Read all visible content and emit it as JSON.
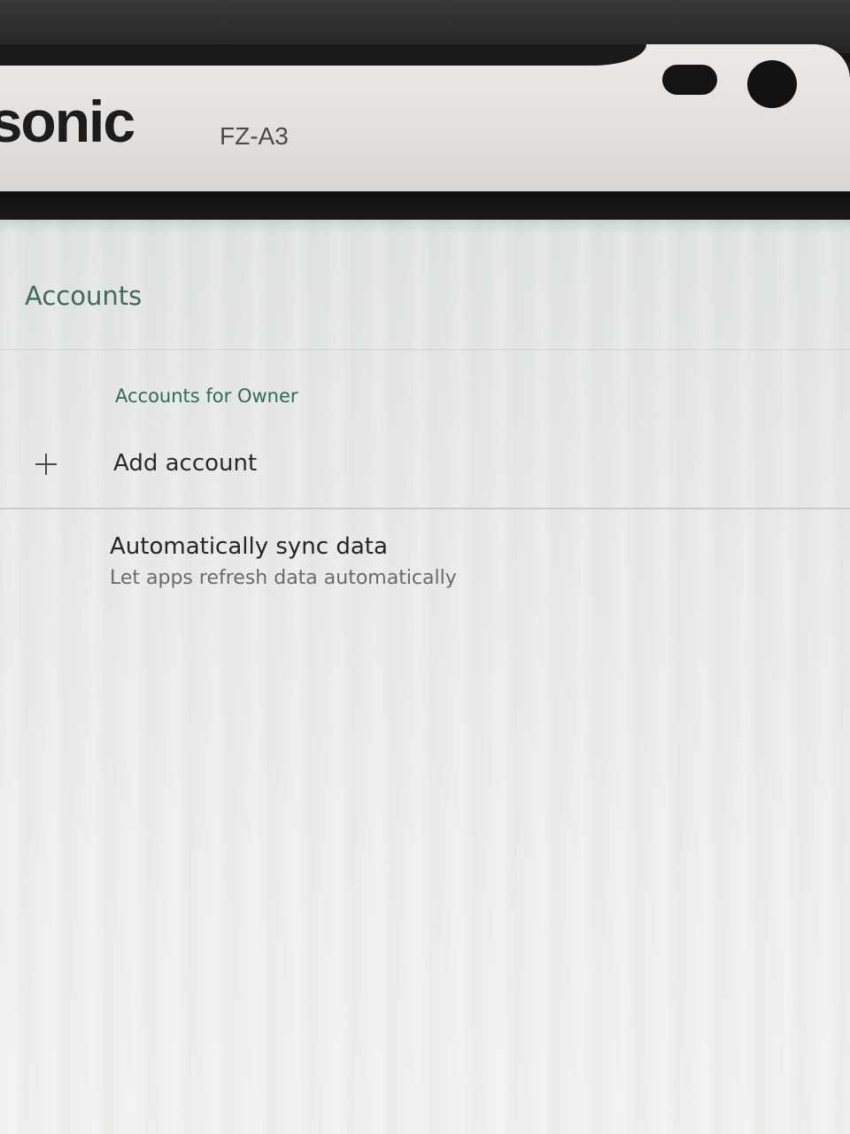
{
  "device": {
    "brand": "asonic",
    "model": "FZ-A3"
  },
  "app_bar": {
    "title": "Accounts"
  },
  "accounts_section": {
    "header": "Accounts for Owner",
    "add_account": {
      "icon": "plus-icon",
      "label": "Add account"
    }
  },
  "sync_setting": {
    "title": "Automatically sync data",
    "summary": "Let apps refresh data automatically"
  },
  "colors": {
    "accent": "#3f6b5f",
    "section_header": "#2f6a5a",
    "primary_text": "#252525",
    "secondary_text": "#6a6a6a"
  }
}
